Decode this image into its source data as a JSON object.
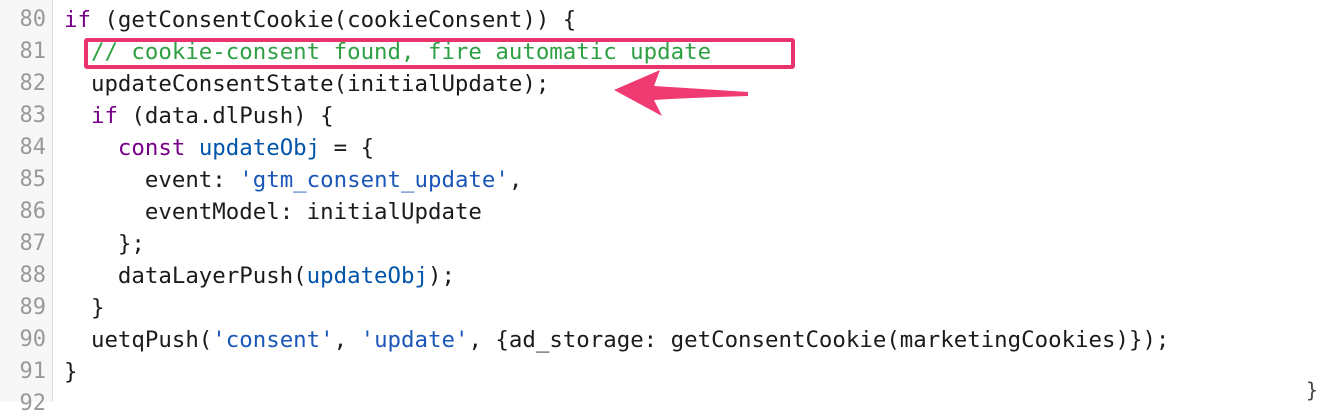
{
  "editor": {
    "lines": [
      {
        "num": "80",
        "indent": "",
        "tokens": [
          {
            "t": "if",
            "c": "kw"
          },
          {
            "t": " (getConsentCookie(cookieConsent)) {",
            "c": ""
          }
        ]
      },
      {
        "num": "81",
        "indent": "  ",
        "tokens": [
          {
            "t": "// cookie-consent found, fire automatic update",
            "c": "cmt"
          }
        ]
      },
      {
        "num": "82",
        "indent": "  ",
        "tokens": [
          {
            "t": "updateConsentState(initialUpdate);",
            "c": ""
          }
        ]
      },
      {
        "num": "83",
        "indent": "  ",
        "tokens": [
          {
            "t": "if",
            "c": "kw"
          },
          {
            "t": " (data.dlPush) {",
            "c": ""
          }
        ]
      },
      {
        "num": "84",
        "indent": "    ",
        "tokens": [
          {
            "t": "const",
            "c": "kw"
          },
          {
            "t": " ",
            "c": ""
          },
          {
            "t": "updateObj",
            "c": "var"
          },
          {
            "t": " = {",
            "c": ""
          }
        ]
      },
      {
        "num": "85",
        "indent": "      ",
        "tokens": [
          {
            "t": "event: ",
            "c": ""
          },
          {
            "t": "'gtm_consent_update'",
            "c": "str"
          },
          {
            "t": ",",
            "c": ""
          }
        ]
      },
      {
        "num": "86",
        "indent": "      ",
        "tokens": [
          {
            "t": "eventModel: initialUpdate",
            "c": ""
          }
        ]
      },
      {
        "num": "87",
        "indent": "    ",
        "tokens": [
          {
            "t": "};",
            "c": ""
          }
        ]
      },
      {
        "num": "88",
        "indent": "    ",
        "tokens": [
          {
            "t": "dataLayerPush(",
            "c": ""
          },
          {
            "t": "updateObj",
            "c": "var"
          },
          {
            "t": ");",
            "c": ""
          }
        ]
      },
      {
        "num": "89",
        "indent": "  ",
        "tokens": [
          {
            "t": "}",
            "c": ""
          }
        ]
      },
      {
        "num": "90",
        "indent": "  ",
        "tokens": [
          {
            "t": "uetqPush(",
            "c": ""
          },
          {
            "t": "'consent'",
            "c": "str"
          },
          {
            "t": ", ",
            "c": ""
          },
          {
            "t": "'update'",
            "c": "str"
          },
          {
            "t": ", {ad_storage: getConsentCookie(marketingCookies)});",
            "c": ""
          }
        ]
      },
      {
        "num": "91",
        "indent": "",
        "tokens": [
          {
            "t": "}",
            "c": ""
          }
        ]
      },
      {
        "num": "92",
        "indent": "",
        "tokens": []
      }
    ]
  },
  "annotation": {
    "highlight_color": "#e8336d",
    "corner_glyph": "}"
  },
  "colors": {
    "keyword": "#770088",
    "variable": "#0055aa",
    "string": "#1a57b8",
    "comment": "#2ea043",
    "default": "#1b1b1b",
    "line_number": "#999999"
  }
}
